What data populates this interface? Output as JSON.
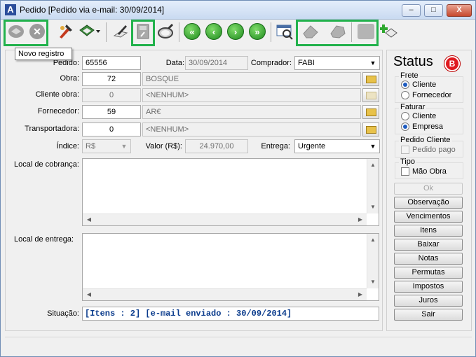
{
  "window": {
    "title": "Pedido   [Pedido via e-mail: 30/09/2014]",
    "app_icon": "A",
    "minimize": "–",
    "maximize": "□",
    "close": "X"
  },
  "toolbar": {
    "tooltip": "Novo registro",
    "icons": [
      "novo-registro-icon",
      "cancel-icon",
      "tools-icon",
      "paint-icon",
      "edit-icon",
      "save-icon",
      "search-icon",
      "first-icon",
      "prev-icon",
      "next-icon",
      "last-icon",
      "preview-icon",
      "eraser-icon",
      "delete-icon",
      "stop-icon",
      "add-icon"
    ]
  },
  "form": {
    "pedido_label": "Pedido:",
    "pedido_value": "65556",
    "data_label": "Data:",
    "data_value": "30/09/2014",
    "comprador_label": "Comprador:",
    "comprador_value": "FABI",
    "obra_label": "Obra:",
    "obra_code": "72",
    "obra_name": "BOSQUE",
    "cliente_obra_label": "Cliente obra:",
    "cliente_obra_code": "0",
    "cliente_obra_name": "<NENHUM>",
    "fornecedor_label": "Fornecedor:",
    "fornecedor_code": "59",
    "fornecedor_name": "AR€",
    "transportadora_label": "Transportadora:",
    "transportadora_code": "0",
    "transportadora_name": "<NENHUM>",
    "indice_label": "Índice:",
    "indice_value": "R$",
    "valor_label": "Valor (R$):",
    "valor_value": "24.970,00",
    "entrega_label": "Entrega:",
    "entrega_value": "Urgente",
    "local_cobranca_label": "Local de cobrança:",
    "local_entrega_label": "Local de entrega:",
    "situacao_label": "Situação:",
    "situacao_value": "[Itens : 2] [e-mail enviado : 30/09/2014]"
  },
  "status": {
    "title": "Status",
    "badge": "B",
    "badge_color": "#e0191f",
    "frete": {
      "title": "Frete",
      "options": [
        "Cliente",
        "Fornecedor"
      ],
      "selected": "Cliente"
    },
    "faturar": {
      "title": "Faturar",
      "options": [
        "Cliente",
        "Empresa"
      ],
      "selected": "Empresa"
    },
    "pedido_cliente": {
      "title": "Pedido Cliente",
      "check_label": "Pedido pago",
      "checked": false
    },
    "tipo": {
      "title": "Tipo",
      "check_label": "Mão Obra",
      "checked": false
    },
    "buttons": [
      "Ok",
      "Observação",
      "Vencimentos",
      "Itens",
      "Baixar",
      "Notas",
      "Permutas",
      "Impostos",
      "Juros",
      "Sair"
    ]
  }
}
